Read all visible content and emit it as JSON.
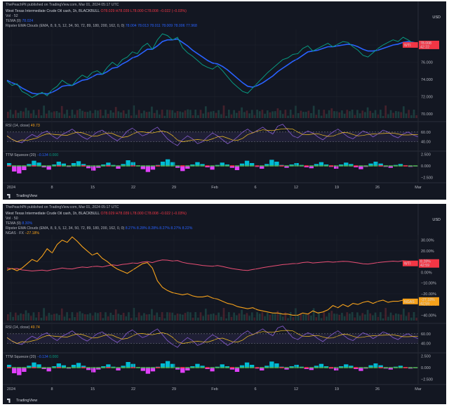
{
  "chart_data": [
    {
      "type": "line",
      "panel": "top",
      "header": {
        "published": "ThePeachPit published on TradingView.com, Mar 01, 2024 05:17 UTC",
        "symbol": "West Texas Intermediate Crude Oil cash, 1h, BLACKBULL",
        "ohlc": [
          "O78.029",
          "H78.039",
          "L78.000",
          "C78.008",
          "−0.022 (−0.03%)"
        ],
        "vol": "Vol · 52",
        "tema": "TEMA (9)",
        "tema_val": "78.024",
        "ripster": "Ripster EMA Clouds (EMA, 8, 9, 5, 12, 34, 50, 72, 89, 180, 200, 162, 0, 0)",
        "ripster_vals": [
          "78.004",
          "78.013",
          "78.011",
          "78.009",
          "78.006",
          "77.968"
        ]
      },
      "currency": "USD",
      "price_axis": [
        "78.000",
        "76.000",
        "74.000",
        "72.000",
        "70.000"
      ],
      "ylim": [
        69.5,
        79.8
      ],
      "wti_label": "WTI",
      "wti_price": "78.008",
      "wti_time": "42:22",
      "series_price": [
        73.8,
        73.3,
        73.5,
        72.6,
        72.3,
        71.9,
        72.2,
        72.5,
        72.1,
        72.8,
        73.2,
        73.9,
        73.5,
        73.3,
        74.0,
        74.5,
        74.2,
        74.8,
        75.0,
        74.6,
        75.4,
        76.0,
        75.6,
        76.3,
        76.6,
        77.2,
        77.0,
        77.8,
        78.2,
        77.5,
        78.6,
        79.3,
        79.1,
        78.6,
        78.9,
        77.7,
        77.1,
        76.7,
        76.2,
        75.7,
        75.4,
        75.2,
        75.6,
        75.0,
        74.3,
        73.6,
        73.1,
        72.6,
        72.4,
        73.0,
        73.6,
        74.2,
        74.8,
        75.3,
        75.8,
        76.3,
        76.5,
        76.9,
        77.0,
        77.6,
        77.9,
        77.3,
        77.6,
        77.9,
        78.2,
        77.8,
        78.1,
        78.4,
        78.3,
        77.8,
        77.4,
        76.8,
        76.6,
        77.1,
        77.6,
        78.0,
        78.3,
        78.6,
        78.4,
        78.9,
        78.6,
        78.2,
        78.0
      ],
      "series_ema": [
        73.9,
        73.6,
        73.4,
        73.0,
        72.7,
        72.4,
        72.3,
        72.4,
        72.3,
        72.5,
        72.8,
        73.2,
        73.3,
        73.3,
        73.6,
        73.9,
        74.0,
        74.3,
        74.6,
        74.6,
        74.9,
        75.3,
        75.4,
        75.8,
        76.1,
        76.5,
        76.7,
        77.1,
        77.5,
        77.5,
        77.9,
        78.4,
        78.6,
        78.6,
        78.7,
        78.3,
        77.9,
        77.4,
        77.0,
        76.6,
        76.2,
        75.9,
        75.8,
        75.5,
        75.1,
        74.6,
        74.1,
        73.6,
        73.2,
        73.1,
        73.3,
        73.6,
        74.0,
        74.4,
        74.9,
        75.3,
        75.7,
        76.1,
        76.4,
        76.8,
        77.2,
        77.3,
        77.4,
        77.6,
        77.8,
        77.8,
        77.9,
        78.0,
        78.1,
        78.0,
        77.8,
        77.5,
        77.3,
        77.3,
        77.4,
        77.6,
        77.8,
        78.0,
        78.1,
        78.3,
        78.4,
        78.3,
        78.2
      ],
      "rsi": {
        "label": "RSI (14, close)",
        "value": "49.73",
        "axis": [
          "60.00",
          "40.00"
        ],
        "ylim": [
          25,
          80
        ],
        "values": [
          52,
          45,
          40,
          38,
          48,
          55,
          50,
          58,
          62,
          52,
          46,
          55,
          60,
          66,
          58,
          50,
          45,
          52,
          60,
          64,
          56,
          48,
          42,
          50,
          62,
          68,
          60,
          52,
          56,
          64,
          70,
          58,
          46,
          38,
          32,
          44,
          52,
          46,
          36,
          40,
          50,
          58,
          52,
          44,
          36,
          42,
          50,
          60,
          66,
          58,
          64,
          70,
          62,
          56,
          72,
          76,
          64,
          52,
          48,
          56,
          62,
          58,
          50,
          44,
          52,
          60,
          66,
          58,
          50,
          46,
          54,
          62,
          58,
          50,
          56,
          64,
          60,
          52,
          48,
          56,
          60,
          54,
          50
        ]
      },
      "squeeze": {
        "label": "TTM Squeeze (20)",
        "value": "−0.134",
        "value2": "0.000",
        "axis": [
          "2.500",
          "0.000",
          "−2.500"
        ],
        "ylim": [
          -3,
          3
        ],
        "values": [
          0.6,
          -1.2,
          -1.6,
          -0.9,
          0.4,
          1.1,
          0.7,
          -0.3,
          -0.8,
          0.3,
          0.9,
          0.5,
          -0.2,
          0.6,
          1.0,
          0.4,
          -0.5,
          -1.0,
          -0.4,
          0.3,
          0.7,
          0.2,
          -0.6,
          0.4,
          1.2,
          0.8,
          0.1,
          -0.7,
          -1.3,
          -0.8,
          0.2,
          0.9,
          1.4,
          0.8,
          -0.4,
          -1.1,
          -0.6,
          0.3,
          0.8,
          0.4,
          -0.3,
          -0.8,
          0.2,
          0.7,
          0.3,
          -0.4,
          -0.9,
          0.5,
          1.1,
          0.6,
          -0.2,
          -0.6,
          0.4,
          1.3,
          0.9,
          0.2,
          -0.4,
          0.3,
          0.6,
          0.2,
          -0.3,
          -0.5,
          0.4,
          0.8,
          0.3,
          -0.2,
          -0.6,
          0.3,
          0.7,
          0.4,
          -0.3,
          -0.7,
          -0.2,
          0.5,
          0.9,
          0.5,
          -0.2,
          -0.4,
          0.2,
          0.4,
          0.1,
          -0.2,
          -0.1
        ]
      },
      "x_ticks": [
        "2024",
        "8",
        "15",
        "22",
        "29",
        "Feb",
        "6",
        "12",
        "19",
        "26",
        "Mar"
      ],
      "footer": "TradingView"
    },
    {
      "type": "line",
      "panel": "bottom",
      "header": {
        "published": "ThePeachPit published on TradingView.com, Mar 01, 2024 05:17 UTC",
        "symbol": "West Texas Intermediate Crude Oil cash, 1h, BLACKBULL",
        "ohlc": [
          "O78.029",
          "H78.039",
          "L78.000",
          "C78.008",
          "−0.022 (−0.03%)"
        ],
        "vol": "Vol · 50",
        "tema": "TEMA (9)",
        "tema_val": "8.30%",
        "ripster": "Ripster EMA Clouds (EMA, 8, 9, 5, 12, 34, 50, 72, 89, 180, 200, 162, 0, 0)",
        "ripster_vals": [
          "8.27%",
          "8.28%",
          "8.28%",
          "8.27%",
          "8.27%",
          "8.22%"
        ],
        "ngas": "NGAS · FX",
        "ngas_val": "−27.18%"
      },
      "currency": "USD",
      "price_axis": [
        "30.00%",
        "20.00%",
        "10.00%",
        "0.00%",
        "−10.00%",
        "−20.00%",
        "−30.00%",
        "−40.00%"
      ],
      "ylim": [
        -45,
        35
      ],
      "wti_label": "WTI",
      "wti_price": "8.28%",
      "wti_time": "42:59",
      "ngas_label": "NGAS",
      "ngas_price": "−27.18%",
      "ngas_time": "42:59",
      "series_wti": [
        4.0,
        3.2,
        3.5,
        2.2,
        1.8,
        1.2,
        1.6,
        2.0,
        1.4,
        2.4,
        3.0,
        4.0,
        3.4,
        3.1,
        4.2,
        4.9,
        4.5,
        5.3,
        5.6,
        5.0,
        6.1,
        7.0,
        6.4,
        7.4,
        7.8,
        8.7,
        8.4,
        9.5,
        10.0,
        9.0,
        10.6,
        11.6,
        11.3,
        10.6,
        11.0,
        9.3,
        8.4,
        7.8,
        7.1,
        6.4,
        6.0,
        5.7,
        6.3,
        5.4,
        4.4,
        3.4,
        2.7,
        2.0,
        1.7,
        2.6,
        3.4,
        4.3,
        5.1,
        5.8,
        6.5,
        7.2,
        7.5,
        8.1,
        8.2,
        9.1,
        9.5,
        8.7,
        9.1,
        9.5,
        9.9,
        9.4,
        9.8,
        10.2,
        10.1,
        9.4,
        8.8,
        8.0,
        7.7,
        8.4,
        9.1,
        9.6,
        10.0,
        10.4,
        10.1,
        10.8,
        10.4,
        9.8,
        9.5
      ],
      "series_ngas": [
        2.0,
        3.5,
        1.5,
        4.0,
        8.0,
        12.0,
        10.0,
        15.0,
        22.0,
        18.0,
        26.0,
        30.0,
        28.0,
        33.0,
        29.0,
        24.0,
        20.0,
        16.0,
        18.0,
        13.0,
        10.0,
        6.0,
        3.0,
        1.0,
        -1.0,
        2.0,
        5.0,
        8.0,
        9.0,
        4.0,
        -8.0,
        -14.0,
        -17.0,
        -19.0,
        -20.0,
        -21.0,
        -20.0,
        -22.0,
        -23.0,
        -23.0,
        -22.0,
        -24.0,
        -25.0,
        -27.0,
        -29.0,
        -30.0,
        -32.0,
        -33.0,
        -34.0,
        -33.0,
        -35.0,
        -36.0,
        -37.0,
        -38.0,
        -38.0,
        -39.0,
        -39.0,
        -40.0,
        -40.0,
        -38.0,
        -39.0,
        -36.0,
        -38.0,
        -37.0,
        -35.0,
        -31.0,
        -33.0,
        -30.0,
        -32.0,
        -29.0,
        -30.0,
        -28.0,
        -27.0,
        -29.0,
        -27.0,
        -26.0,
        -28.0,
        -27.0,
        -27.0,
        -26.0,
        -27.0,
        -27.0,
        -27.0
      ],
      "rsi": {
        "label": "RSI (14, close)",
        "value": "49.74",
        "axis": [
          "60.00",
          "40.00"
        ],
        "ylim": [
          25,
          80
        ],
        "values": [
          52,
          45,
          40,
          38,
          48,
          55,
          50,
          58,
          62,
          52,
          46,
          55,
          60,
          66,
          58,
          50,
          45,
          52,
          60,
          64,
          56,
          48,
          42,
          50,
          62,
          68,
          60,
          52,
          56,
          64,
          70,
          58,
          46,
          38,
          32,
          44,
          52,
          46,
          36,
          40,
          50,
          58,
          52,
          44,
          36,
          42,
          50,
          60,
          66,
          58,
          64,
          70,
          62,
          56,
          72,
          76,
          64,
          52,
          48,
          56,
          62,
          58,
          50,
          44,
          52,
          60,
          66,
          58,
          50,
          46,
          54,
          62,
          58,
          50,
          56,
          64,
          60,
          52,
          48,
          56,
          60,
          54,
          50
        ]
      },
      "squeeze": {
        "label": "TTM Squeeze (20)",
        "value": "−0.134",
        "value2": "0.000",
        "axis": [
          "2.500",
          "0.000",
          "−2.500"
        ],
        "ylim": [
          -3,
          3
        ],
        "values": [
          0.6,
          -1.2,
          -1.6,
          -0.9,
          0.4,
          1.1,
          0.7,
          -0.3,
          -0.8,
          0.3,
          0.9,
          0.5,
          -0.2,
          0.6,
          1.0,
          0.4,
          -0.5,
          -1.0,
          -0.4,
          0.3,
          0.7,
          0.2,
          -0.6,
          0.4,
          1.2,
          0.8,
          0.1,
          -0.7,
          -1.3,
          -0.8,
          0.2,
          0.9,
          1.4,
          0.8,
          -0.4,
          -1.1,
          -0.6,
          0.3,
          0.8,
          0.4,
          -0.3,
          -0.8,
          0.2,
          0.7,
          0.3,
          -0.4,
          -0.9,
          0.5,
          1.1,
          0.6,
          -0.2,
          -0.6,
          0.4,
          1.3,
          0.9,
          0.2,
          -0.4,
          0.3,
          0.6,
          0.2,
          -0.3,
          -0.5,
          0.4,
          0.8,
          0.3,
          -0.2,
          -0.6,
          0.3,
          0.7,
          0.4,
          -0.3,
          -0.7,
          -0.2,
          0.5,
          0.9,
          0.5,
          -0.2,
          -0.4,
          0.2,
          0.4,
          0.1,
          -0.2,
          -0.1
        ]
      },
      "x_ticks": [
        "2024",
        "8",
        "15",
        "22",
        "29",
        "Feb",
        "6",
        "12",
        "19",
        "26",
        "Mar"
      ],
      "footer": "TradingView"
    }
  ],
  "colors": {
    "background": "#131722",
    "up": "#089981",
    "down": "#f23645",
    "wti_line": "#e84e74",
    "ngas_line": "#f7a21b",
    "ema": "#2962ff",
    "rsi_line": "#7e57c2",
    "rsi_ma": "#f7c325",
    "squeeze_pos": "#00bcd4",
    "squeeze_neg": "#e040fb"
  }
}
